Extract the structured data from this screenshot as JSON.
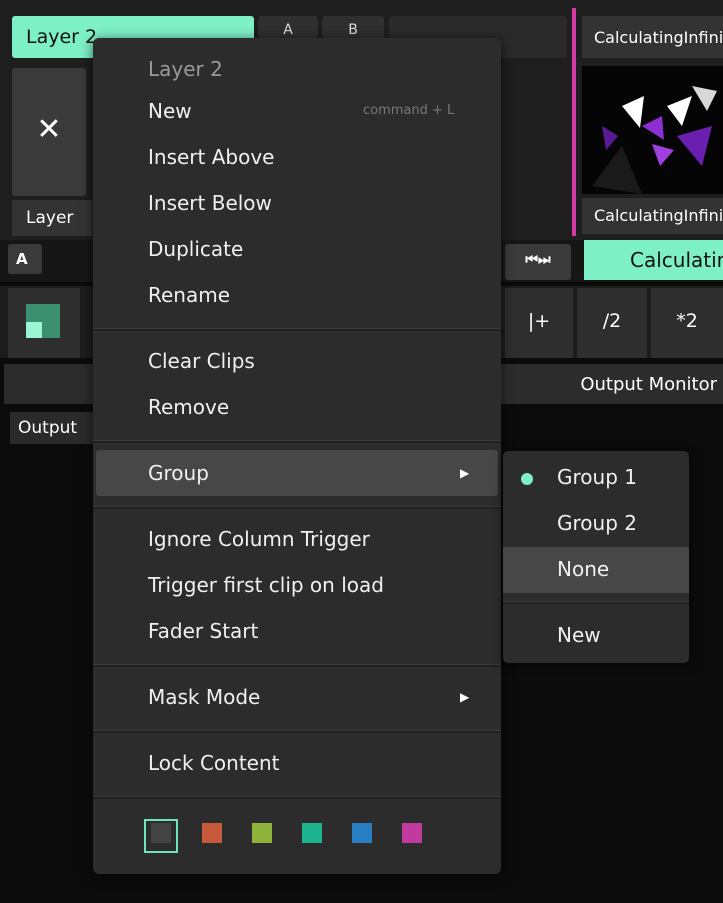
{
  "background": {
    "layer_tab": "Layer 2",
    "tab_a": "A",
    "tab_b": "B",
    "clip_name_top": "CalculatingInfinity",
    "clip_name_bottom": "CalculatingInfinity",
    "close_symbol": "✕",
    "layer_label": "Layer",
    "deck_label": "A",
    "transport_symbol": "⏮⏭",
    "calc_button": "Calculating",
    "controls": [
      "|+",
      "/2",
      "*2"
    ],
    "output_monitor": "Output Monitor",
    "output_label": "Output"
  },
  "menu": {
    "title": "Layer 2",
    "items": {
      "new": "New",
      "new_shortcut": "command + L",
      "insert_above": "Insert Above",
      "insert_below": "Insert Below",
      "duplicate": "Duplicate",
      "rename": "Rename",
      "clear_clips": "Clear Clips",
      "remove": "Remove",
      "group": "Group",
      "ignore_column_trigger": "Ignore Column Trigger",
      "trigger_first_clip": "Trigger first clip on load",
      "fader_start": "Fader Start",
      "mask_mode": "Mask Mode",
      "lock_content": "Lock Content"
    },
    "submenu_arrow": "▶",
    "colors": [
      "#444444",
      "#c75a3a",
      "#8fb33a",
      "#1db38f",
      "#2a7fc4",
      "#c03aa0"
    ],
    "selected_color_index": 0
  },
  "submenu": {
    "items": [
      "Group 1",
      "Group 2",
      "None",
      "New"
    ],
    "checked_item": "Group 1",
    "highlighted_item": "None"
  },
  "accent_color": "#7ef0c8"
}
